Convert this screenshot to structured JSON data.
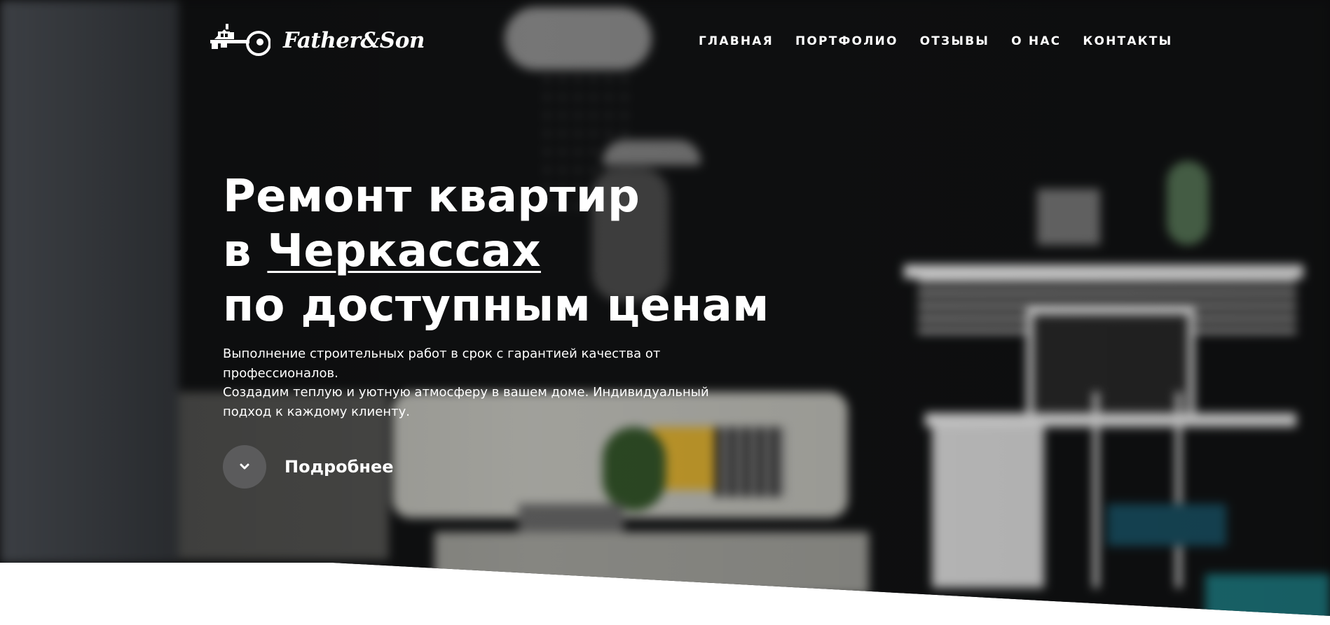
{
  "brand": {
    "name": "Father&Son",
    "logo_icon": "house-key-icon"
  },
  "nav": {
    "items": [
      {
        "label": "ГЛАВНАЯ"
      },
      {
        "label": "ПОРТФОЛИО"
      },
      {
        "label": "ОТЗЫВЫ"
      },
      {
        "label": "О НАС"
      },
      {
        "label": "КОНТАКТЫ"
      }
    ]
  },
  "hero": {
    "title_line1": "Ремонт квартир",
    "title_line2_prefix": "в ",
    "title_city": "Черкассах",
    "title_line3": "по доступным ценам",
    "desc_line1": "Выполнение строительных работ в срок с гарантией качества от профессионалов.",
    "desc_line2": "Создадим теплую и уютную атмосферу в вашем доме. Индивидуальный подход к каждому клиенту.",
    "cta_label": "Подробнее",
    "cta_icon": "chevron-down-icon"
  },
  "colors": {
    "hero_background": "#0d0d0e",
    "text": "#ffffff",
    "cta_circle": "#5b5b5c",
    "page_background": "#ffffff"
  }
}
